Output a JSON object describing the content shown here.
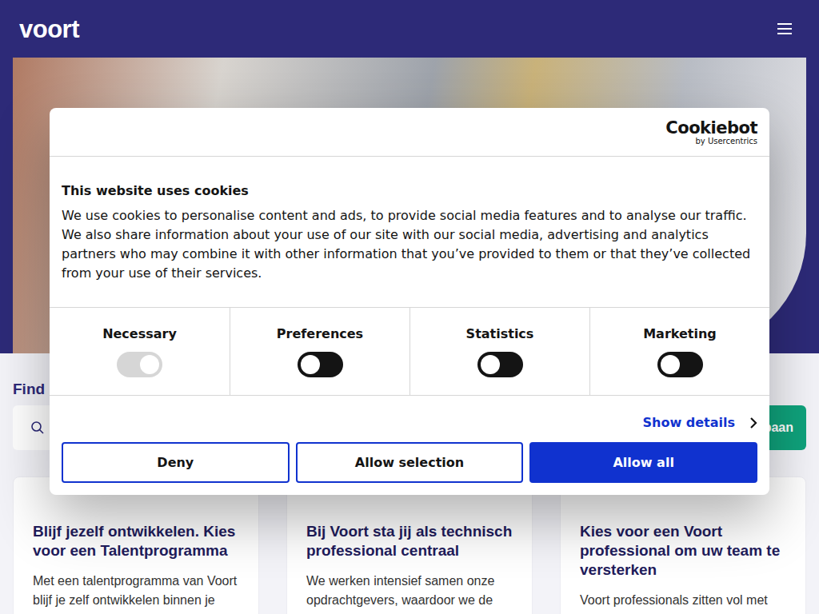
{
  "header": {
    "logo": "voort"
  },
  "search": {
    "label": "Find",
    "button": "baan"
  },
  "cards": [
    {
      "title": "Blijf jezelf ontwikkelen. Kies voor een Talentprogramma",
      "text": "Met een talentprogramma van Voort blijf je zelf ontwikkelen binnen je"
    },
    {
      "title": "Bij Voort sta jij als technisch professional centraal",
      "text": "We werken intensief samen onze opdrachtgevers, waardoor we de"
    },
    {
      "title": "Kies voor een Voort professional om uw team te versterken",
      "text": "Voort professionals zitten vol met"
    }
  ],
  "cookie_dialog": {
    "brand": "Cookiebot",
    "brand_sub": "by Usercentrics",
    "title": "This website uses cookies",
    "body": "We use cookies to personalise content and ads, to provide social media features and to analyse our traffic. We also share information about your use of our site with our social media, advertising and analytics partners who may combine it with other information that you’ve provided to them or that they’ve collected from your use of their services.",
    "toggles": [
      {
        "label": "Necessary",
        "on": true,
        "disabled": true
      },
      {
        "label": "Preferences",
        "on": false,
        "disabled": false
      },
      {
        "label": "Statistics",
        "on": false,
        "disabled": false
      },
      {
        "label": "Marketing",
        "on": false,
        "disabled": false
      }
    ],
    "details": "Show details",
    "buttons": [
      {
        "label": "Deny",
        "primary": false
      },
      {
        "label": "Allow selection",
        "primary": false
      },
      {
        "label": "Allow all",
        "primary": true
      }
    ]
  }
}
